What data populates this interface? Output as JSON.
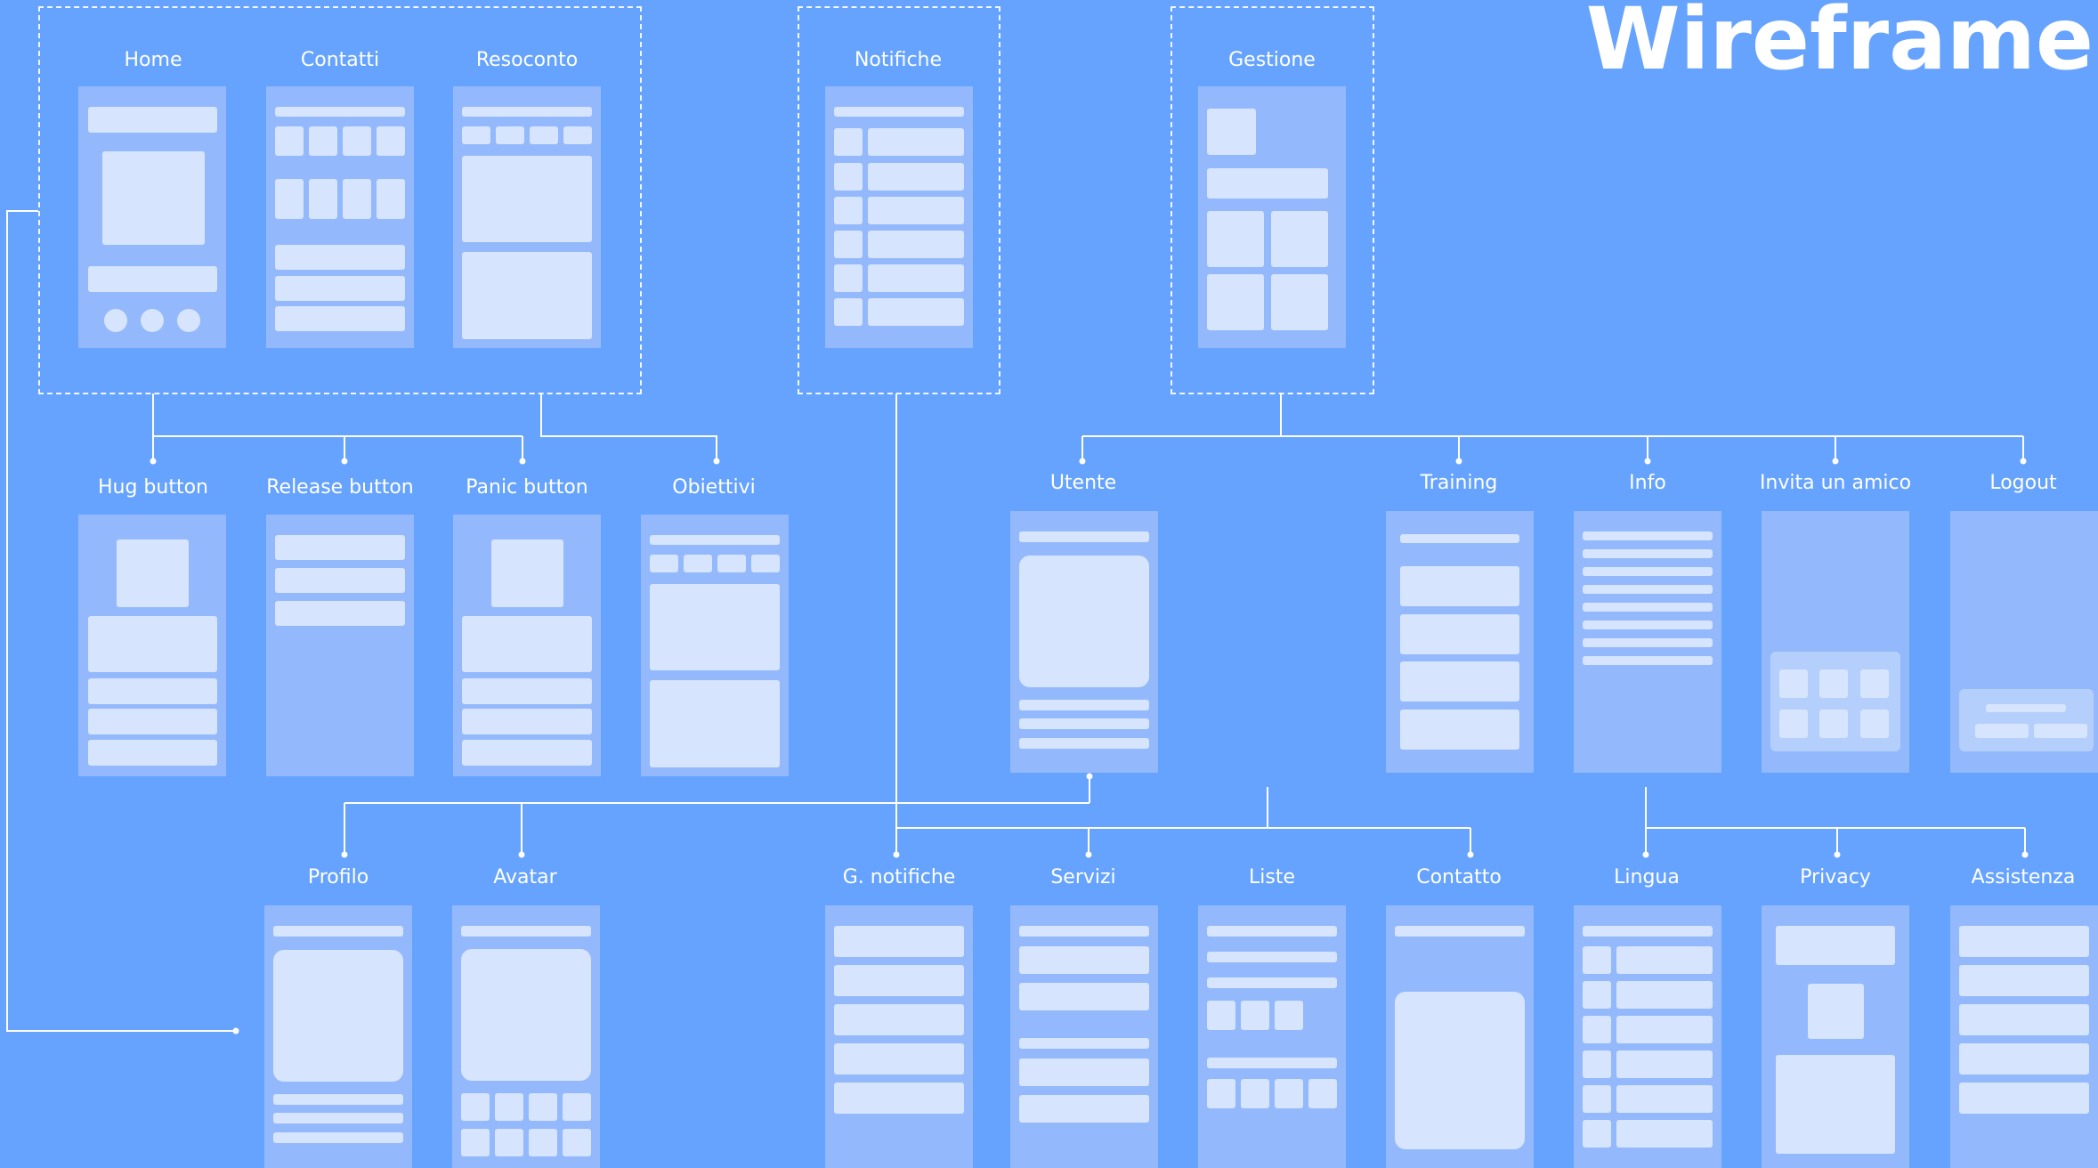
{
  "title": "Wireframe",
  "screens": {
    "home": "Home",
    "contatti": "Contatti",
    "resoconto": "Resoconto",
    "notifiche": "Notifiche",
    "gestione": "Gestione",
    "hug_button": "Hug button",
    "release_button": "Release button",
    "panic_button": "Panic button",
    "obiettivi": "Obiettivi",
    "utente": "Utente",
    "training": "Training",
    "info": "Info",
    "invita_amico": "Invita un amico",
    "logout": "Logout",
    "profilo": "Profilo",
    "avatar": "Avatar",
    "g_notifiche": "G. notifiche",
    "servizi": "Servizi",
    "liste": "Liste",
    "contatto": "Contatto",
    "lingua": "Lingua",
    "privacy": "Privacy",
    "assistenza": "Assistenza"
  },
  "colors": {
    "background": "#66A3FE",
    "screen": "#93B9FC",
    "block": "#D6E5FD",
    "line": "#FFFFFF"
  }
}
